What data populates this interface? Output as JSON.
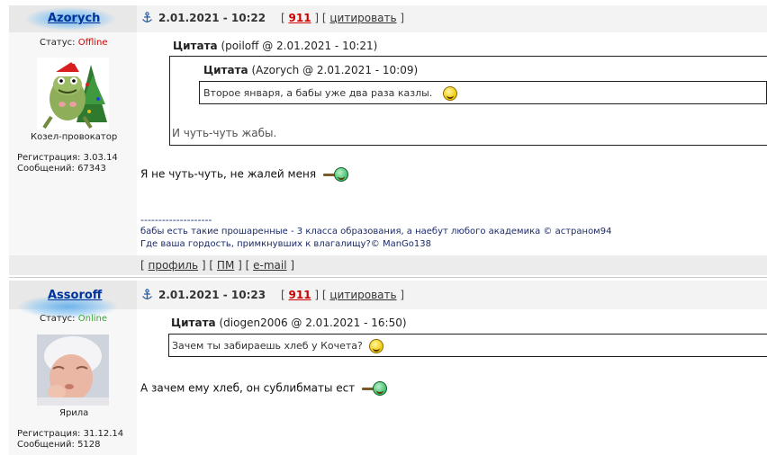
{
  "posts": [
    {
      "username": "Azorych",
      "status_label": "Статус:",
      "status": "Offline",
      "rank": "Козел-провокатор",
      "reg_label": "Регистрация:",
      "reg_date": "3.03.14",
      "msgs_label": "Сообщений:",
      "msgs_count": "67343",
      "datetime": "2.01.2021 - 10:22",
      "post_num": "911",
      "quote_action": "цитировать",
      "quotes": [
        {
          "title": "Цитата",
          "meta": "(poiloff @ 2.01.2021 - 10:21)",
          "nested_title": "Цитата",
          "nested_meta": "(Azorych @ 2.01.2021 - 10:09)",
          "nested_text": "Второе января, а бабы уже два раза казлы.",
          "text": "И чуть-чуть жабы."
        }
      ],
      "message": "Я не чуть-чуть, не жалей меня",
      "signature_sep": "--------------------",
      "signature_line1": "бабы есть такие прошаренные - 3 класса образования, а наебут любого академика © астраном94",
      "signature_line2": "Где ваша гордость, примкнувших к влагалищу?© ManGo138",
      "footer": {
        "profile": "профиль",
        "pm": "ПМ",
        "email": "e-mail"
      }
    },
    {
      "username": "Assoroff",
      "status_label": "Статус:",
      "status": "Online",
      "rank": "Ярила",
      "reg_label": "Регистрация:",
      "reg_date": "31.12.14",
      "msgs_label": "Сообщений:",
      "msgs_count": "5128",
      "datetime": "2.01.2021 - 10:23",
      "post_num": "911",
      "quote_action": "цитировать",
      "quotes": [
        {
          "title": "Цитата",
          "meta": "(diogen2006 @ 2.01.2021 - 16:50)",
          "text": "Зачем ты забираешь хлеб у Кочета?"
        }
      ],
      "message": "А зачем ему хлеб, он сублибматы ест"
    }
  ],
  "icons": {
    "post_anchor": "anchor-icon",
    "smile": "smile-icon",
    "smoking": "smoking-smiley-icon"
  },
  "colors": {
    "username": "#003399",
    "offline": "#cc0000",
    "online": "#33aa33",
    "post_num": "#cc0000"
  }
}
